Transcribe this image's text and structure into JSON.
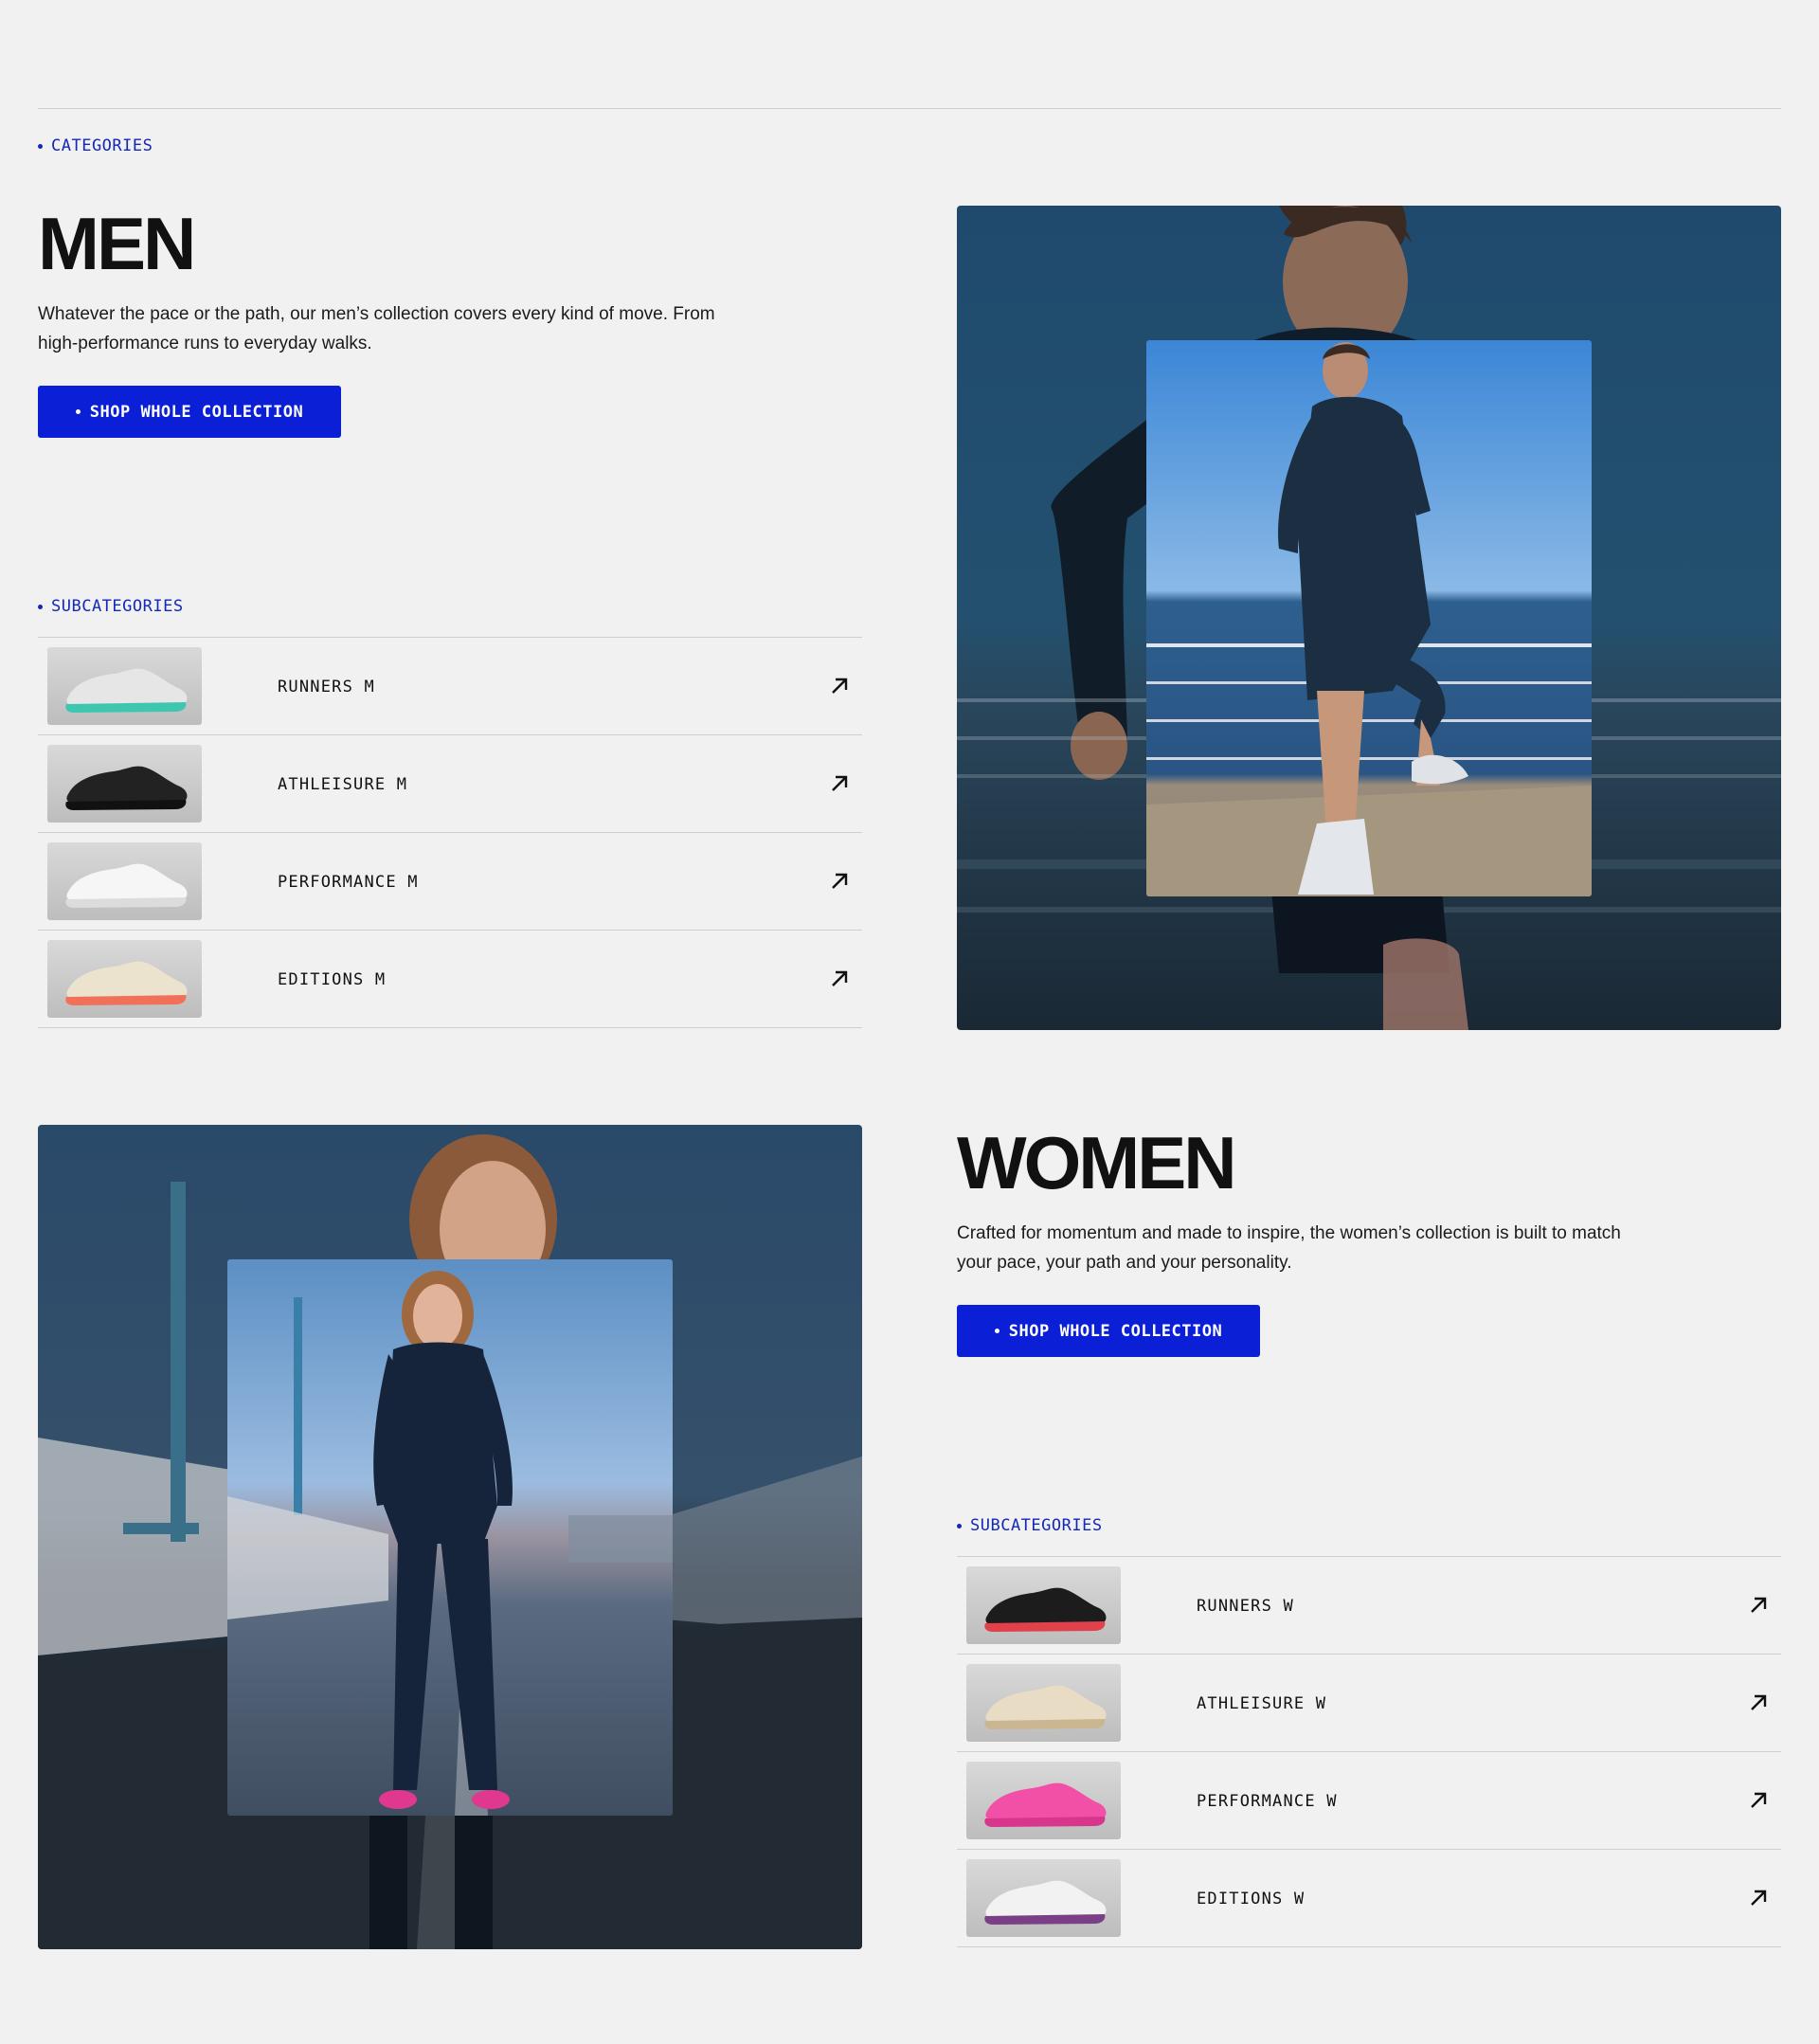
{
  "categories_label": "CATEGORIES",
  "men": {
    "title": "MEN",
    "description_line1": "Whatever the pace or the path, our men’s collection covers every kind of move. From",
    "description_line2": "high-performance runs to everyday walks.",
    "cta_label": "SHOP WHOLE COLLECTION",
    "subcategories_label": "SUBCATEGORIES",
    "subcategories": [
      {
        "label": "RUNNERS M",
        "shoe_color": "#e6e6e6",
        "accent": "#3fc6b0"
      },
      {
        "label": "ATHLEISURE M",
        "shoe_color": "#222222",
        "accent": "#111111"
      },
      {
        "label": "PERFORMANCE M",
        "shoe_color": "#f6f6f6",
        "accent": "#dcdcdc"
      },
      {
        "label": "EDITIONS M",
        "shoe_color": "#ece3cf",
        "accent": "#f0705a"
      }
    ]
  },
  "women": {
    "title": "WOMEN",
    "description_line1": "Crafted for momentum and made to inspire, the women’s collection is built to match",
    "description_line2": "your pace, your path and your personality.",
    "cta_label": "SHOP WHOLE COLLECTION",
    "subcategories_label": "SUBCATEGORIES",
    "subcategories": [
      {
        "label": "RUNNERS W",
        "shoe_color": "#1c1c1c",
        "accent": "#e0414a"
      },
      {
        "label": "ATHLEISURE W",
        "shoe_color": "#e9dcc4",
        "accent": "#cbb692"
      },
      {
        "label": "PERFORMANCE W",
        "shoe_color": "#f24fa6",
        "accent": "#d8358c"
      },
      {
        "label": "EDITIONS W",
        "shoe_color": "#f2f2f2",
        "accent": "#7a3f86"
      }
    ]
  },
  "colors": {
    "accent_blue": "#0a1fd6",
    "label_blue": "#1428b8",
    "background": "#f1f1f1"
  }
}
